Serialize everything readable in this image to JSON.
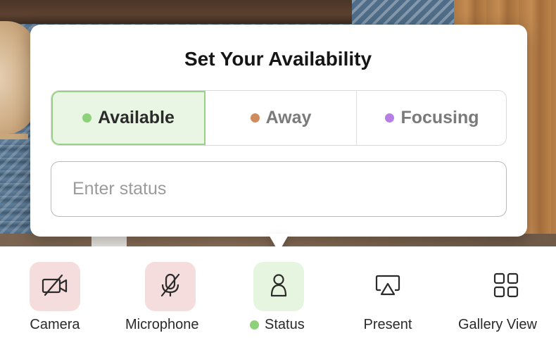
{
  "popover": {
    "title": "Set Your Availability",
    "options": [
      {
        "label": "Available",
        "dot_color": "#8fd07a",
        "selected": true
      },
      {
        "label": "Away",
        "dot_color": "#d08a5c",
        "selected": false
      },
      {
        "label": "Focusing",
        "dot_color": "#b77ee3",
        "selected": false
      }
    ],
    "status_input": {
      "value": "",
      "placeholder": "Enter status"
    }
  },
  "toolbar": {
    "items": [
      {
        "label": "Camera",
        "icon": "camera-off-icon",
        "state": "off"
      },
      {
        "label": "Microphone",
        "icon": "microphone-off-icon",
        "state": "off"
      },
      {
        "label": "Status",
        "icon": "person-icon",
        "state": "active",
        "status_dot_color": "#8fd07a"
      },
      {
        "label": "Present",
        "icon": "screen-share-icon",
        "state": "idle"
      },
      {
        "label": "Gallery View",
        "icon": "grid-icon",
        "state": "idle"
      }
    ]
  },
  "colors": {
    "available_green": "#8fd07a",
    "selected_bg": "#e8f6e3",
    "danger_bg": "#f6dddd"
  }
}
